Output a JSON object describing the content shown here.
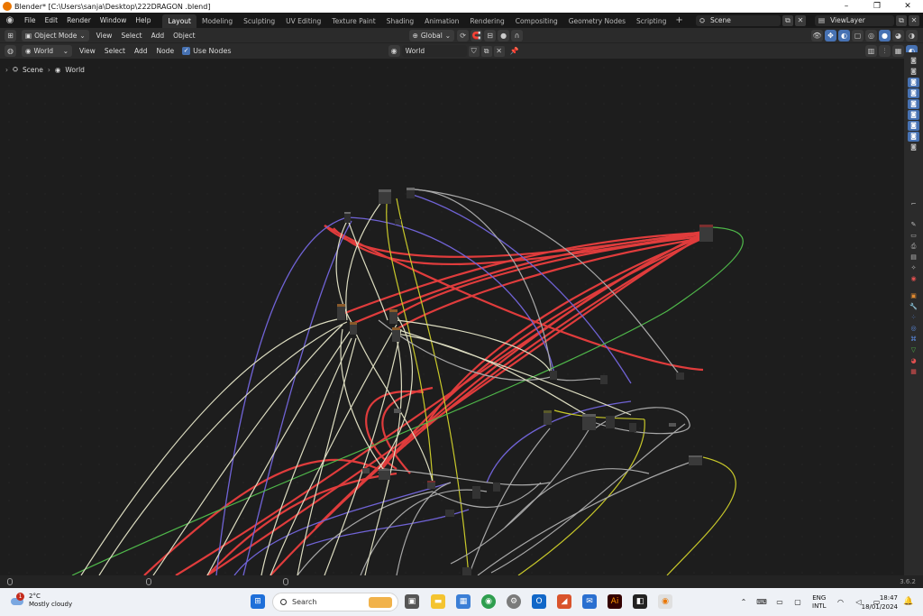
{
  "window": {
    "title": "Blender* [C:\\Users\\sanja\\Desktop\\222DRAGON .blend]",
    "minimize": "–",
    "maximize": "❐",
    "close": "✕"
  },
  "topbar": {
    "menus": [
      "File",
      "Edit",
      "Render",
      "Window",
      "Help"
    ],
    "workspaces": [
      "Layout",
      "Modeling",
      "Sculpting",
      "UV Editing",
      "Texture Paint",
      "Shading",
      "Animation",
      "Rendering",
      "Compositing",
      "Geometry Nodes",
      "Scripting"
    ],
    "active_workspace": "Layout",
    "add_workspace": "+",
    "scene": "Scene",
    "view_layer": "ViewLayer"
  },
  "header1": {
    "mode": "Object Mode",
    "menus": [
      "View",
      "Select",
      "Add",
      "Object"
    ],
    "transform_orientation": "Global"
  },
  "header2": {
    "shader_type": "World",
    "menus": [
      "View",
      "Select",
      "Add",
      "Node"
    ],
    "use_nodes_label": "Use Nodes",
    "use_nodes_checked": true,
    "world_name": "World"
  },
  "breadcrumb": {
    "scene": "Scene",
    "world": "World"
  },
  "statusbar": {
    "version": "3.6.2"
  },
  "taskbar": {
    "weather_temp": "2°C",
    "weather_desc": "Mostly cloudy",
    "weather_badge": "1",
    "search_placeholder": "Search",
    "language": "ENG",
    "layout": "INTL",
    "time": "18:47",
    "date": "18/01/2024"
  },
  "colors": {
    "wire_shader": "#e03c3c",
    "wire_vector": "#7063d6",
    "wire_color": "#c8c82a",
    "wire_float": "#a8a8a8",
    "wire_light": "#d8d8b0",
    "wire_green": "#4fb84a",
    "accent": "#4772b3"
  }
}
